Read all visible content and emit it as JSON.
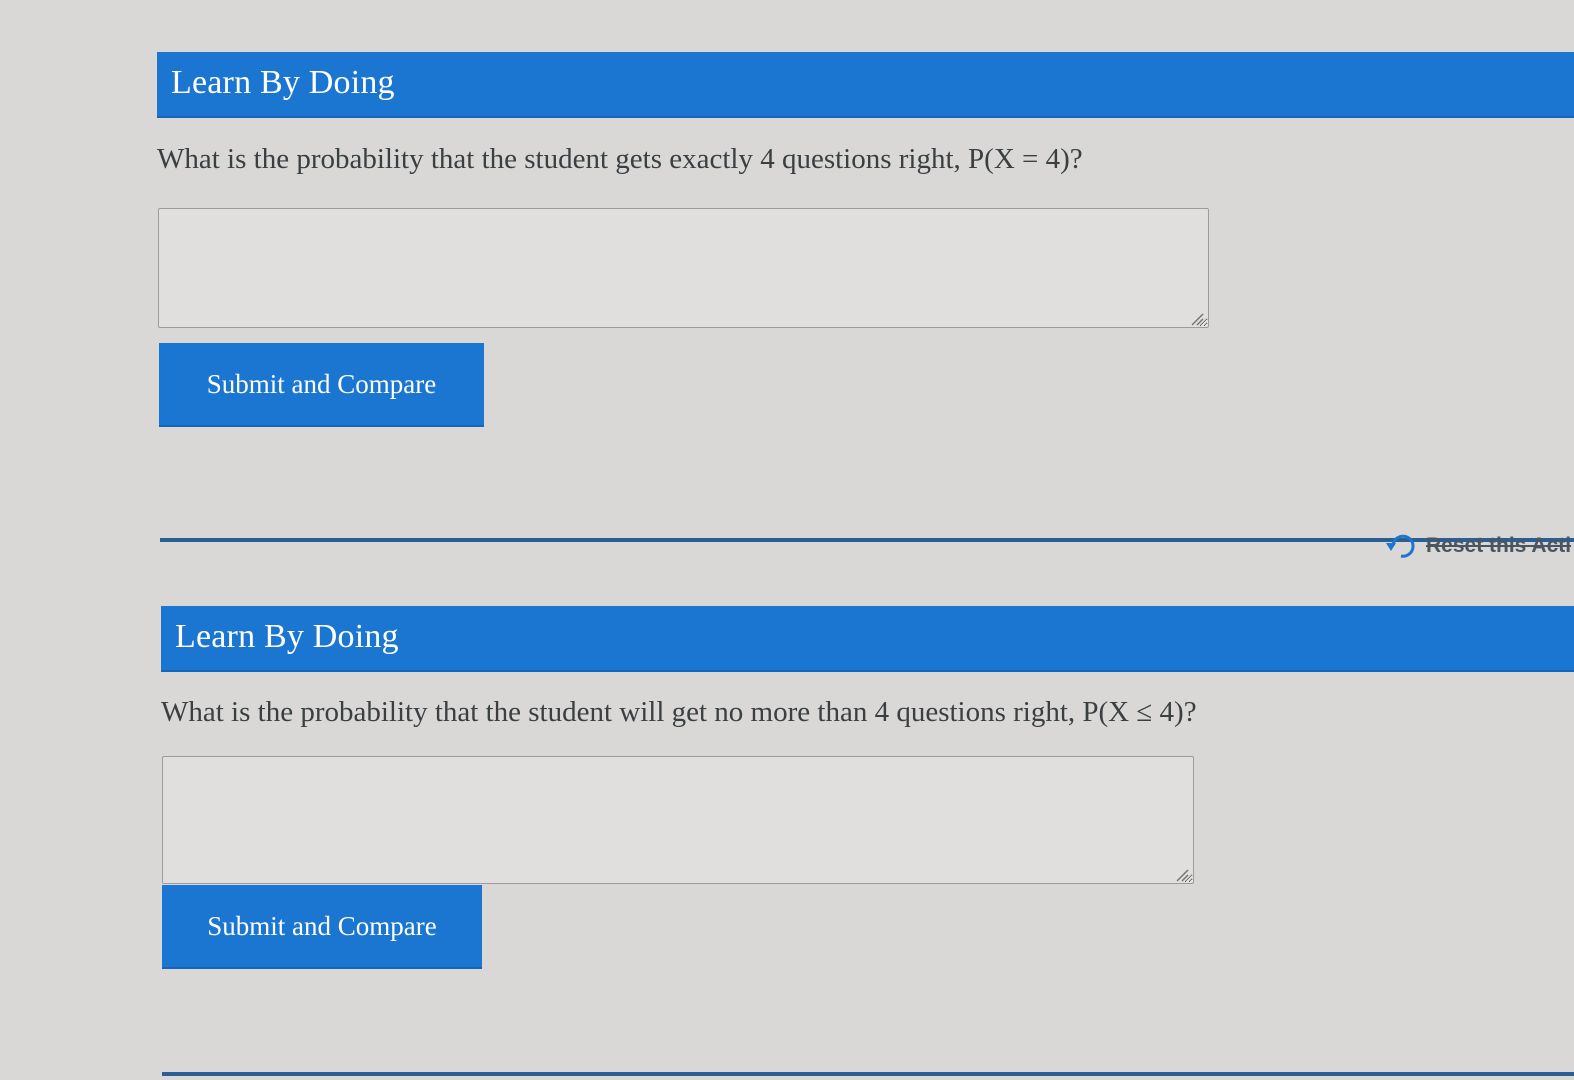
{
  "colors": {
    "header_blue": "#1b76d1",
    "page_background": "#d9d8d6",
    "divider": "#2b5f93"
  },
  "activities": [
    {
      "header_title": "Learn By Doing",
      "question": "What is the probability that the student gets exactly 4 questions right, P(X = 4)?",
      "answer_value": "",
      "submit_label": "Submit and Compare"
    },
    {
      "header_title": "Learn By Doing",
      "question": "What is the probability that the student will get no more than 4 questions right, P(X ≤ 4)?",
      "answer_value": "",
      "submit_label": "Submit and Compare"
    }
  ],
  "reset": {
    "label": "Reset this Acti",
    "icon": "reset-undo-icon"
  }
}
